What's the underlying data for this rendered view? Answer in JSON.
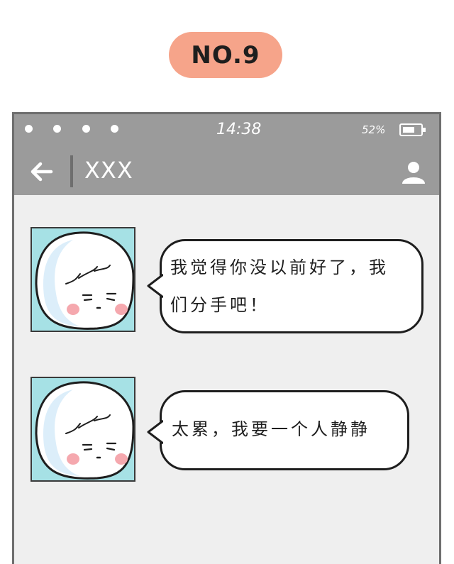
{
  "badge": {
    "label": "NO.9",
    "color": "#f6a48a"
  },
  "status_bar": {
    "time": "14:38",
    "battery": "52%"
  },
  "header": {
    "back_icon": "back-arrow-icon",
    "contact_name": "XXX",
    "profile_icon": "user-icon"
  },
  "messages": [
    {
      "avatar": "sad-face-avatar",
      "line1": "我觉得你没以前好了，我",
      "line2": "们分手吧！"
    },
    {
      "avatar": "sad-face-avatar",
      "line1": "太累，我要一个人静静"
    }
  ],
  "colors": {
    "bar": "#9b9b9b",
    "avatar_bg": "#a6e1e5",
    "chat_bg": "#efefef"
  }
}
